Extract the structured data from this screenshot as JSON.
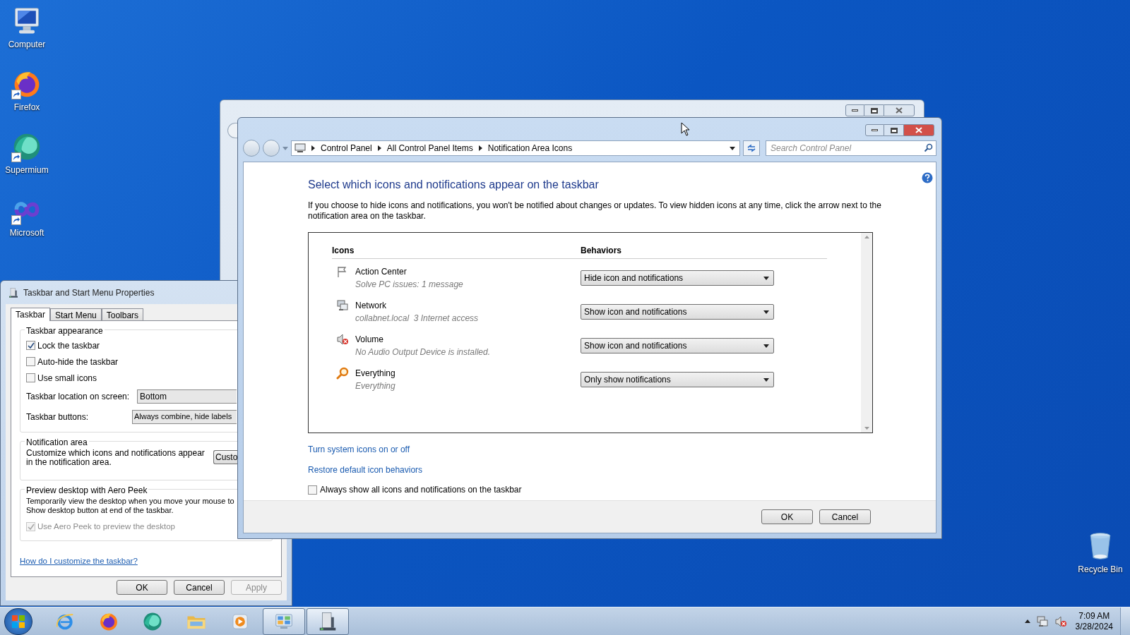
{
  "desktop_icons": [
    {
      "kind": "computer",
      "label": "Computer",
      "shortcut": false
    },
    {
      "kind": "firefox",
      "label": "Firefox",
      "shortcut": true
    },
    {
      "kind": "supermium",
      "label": "Supermium",
      "shortcut": true
    },
    {
      "kind": "infinity",
      "label": "Microsoft",
      "shortcut": true
    },
    {
      "kind": "recycle",
      "label": "Recycle Bin",
      "shortcut": false
    }
  ],
  "main_window": {
    "breadcrumbs": [
      "Control Panel",
      "All Control Panel Items",
      "Notification Area Icons"
    ],
    "search": {
      "placeholder": "Search Control Panel"
    },
    "heading": "Select which icons and notifications appear on the taskbar",
    "description": "If you choose to hide icons and notifications, you won't be notified about changes or updates. To view hidden icons at any time, click the arrow next to the notification area on the taskbar.",
    "table": {
      "columns": [
        "Icons",
        "Behaviors"
      ],
      "rows": [
        {
          "kind": "flag",
          "name": "Action Center",
          "detail": "Solve PC issues: 1 message",
          "behavior": "Hide icon and notifications"
        },
        {
          "kind": "network",
          "name": "Network",
          "detail": "collabnet.local  3 Internet access",
          "behavior": "Show icon and notifications"
        },
        {
          "kind": "volume",
          "name": "Volume",
          "detail": "No Audio Output Device is installed.",
          "behavior": "Show icon and notifications"
        },
        {
          "kind": "search",
          "name": "Everything",
          "detail": "Everything",
          "behavior": "Only show notifications"
        }
      ]
    },
    "links": [
      "Turn system icons on or off",
      "Restore default icon behaviors"
    ],
    "always_show": {
      "label": "Always show all icons and notifications on the taskbar",
      "checked": false
    },
    "buttons": [
      "OK",
      "Cancel"
    ]
  },
  "properties_dialog": {
    "title": "Taskbar and Start Menu Properties",
    "tabs": [
      {
        "label": "Taskbar",
        "selected": true
      },
      {
        "label": "Start Menu",
        "selected": false
      },
      {
        "label": "Toolbars",
        "selected": false
      }
    ],
    "appearance": {
      "title": "Taskbar appearance",
      "checkboxes": [
        {
          "label": "Lock the taskbar",
          "checked": true
        },
        {
          "label": "Auto-hide the taskbar",
          "checked": false
        },
        {
          "label": "Use small icons",
          "checked": false
        }
      ],
      "location": {
        "label": "Taskbar location on screen:",
        "value": "Bottom"
      },
      "buttons_setting": {
        "label": "Taskbar buttons:",
        "value": "Always combine, hide labels"
      }
    },
    "notification": {
      "title": "Notification area",
      "text": "Customize which icons and notifications appear in the notification area.",
      "button": "Custo"
    },
    "aero_peek": {
      "title": "Preview desktop with Aero Peek",
      "lines": [
        "Temporarily view the desktop when you move your mouse to",
        "Show desktop button at end of the taskbar."
      ],
      "checkbox": {
        "label": "Use Aero Peek to preview the desktop",
        "checked": true,
        "disabled": true
      }
    },
    "help_link": "How do I customize the taskbar?",
    "buttons": [
      {
        "label": "OK",
        "disabled": false
      },
      {
        "label": "Cancel",
        "disabled": false
      },
      {
        "label": "Apply",
        "disabled": true
      }
    ]
  },
  "taskbar": {
    "items": [
      {
        "kind": "ie",
        "running": false
      },
      {
        "kind": "firefox",
        "running": false
      },
      {
        "kind": "supermium",
        "running": false
      },
      {
        "kind": "folder",
        "running": false
      },
      {
        "kind": "media",
        "running": false
      },
      {
        "kind": "control-panel",
        "running": true
      },
      {
        "kind": "properties",
        "running": true
      }
    ],
    "time": "7:09 AM",
    "date": "3/28/2024"
  }
}
